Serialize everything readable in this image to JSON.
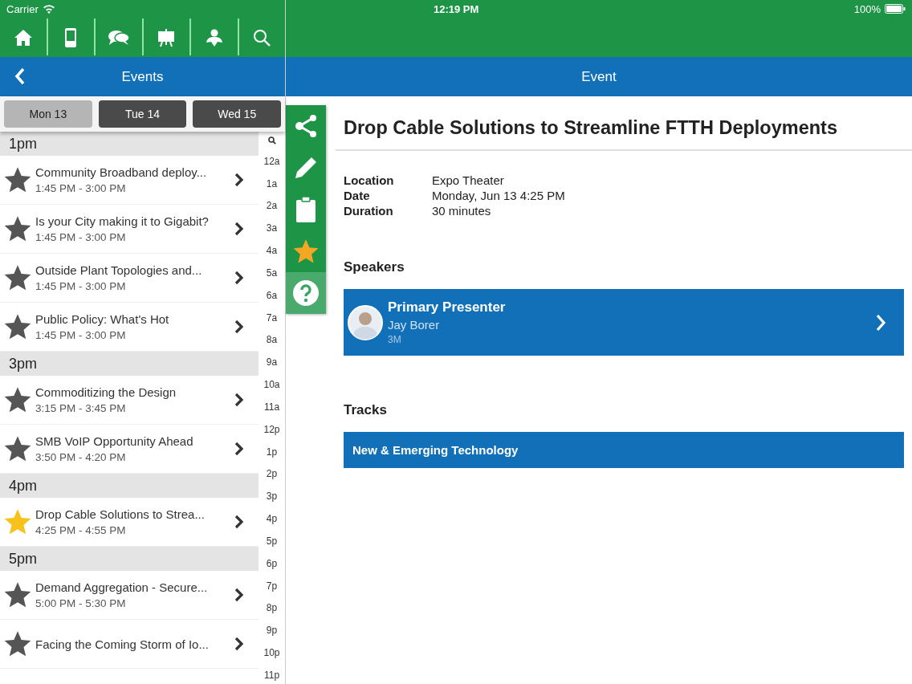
{
  "status_bar": {
    "carrier": "Carrier",
    "time": "12:19 PM",
    "battery": "100%"
  },
  "toolbar": [
    {
      "kind": "home"
    },
    {
      "kind": "device"
    },
    {
      "kind": "chat"
    },
    {
      "kind": "easel"
    },
    {
      "kind": "person"
    },
    {
      "kind": "search"
    }
  ],
  "left_header": {
    "title": "Events"
  },
  "day_tabs": [
    {
      "label": "Mon 13",
      "selected": true
    },
    {
      "label": "Tue 14",
      "selected": false
    },
    {
      "label": "Wed 15",
      "selected": false
    }
  ],
  "sections": [
    {
      "heading": "1pm",
      "events": [
        {
          "title": "Community Broadband deploy...",
          "time": "1:45 PM - 3:00 PM",
          "favorite": false
        },
        {
          "title": "Is your City making it to Gigabit?",
          "time": "1:45 PM - 3:00 PM",
          "favorite": false
        },
        {
          "title": "Outside Plant Topologies and...",
          "time": "1:45 PM - 3:00 PM",
          "favorite": false
        },
        {
          "title": "Public Policy: What's Hot",
          "time": "1:45 PM - 3:00 PM",
          "favorite": false
        }
      ]
    },
    {
      "heading": "3pm",
      "events": [
        {
          "title": "Commoditizing the Design",
          "time": "3:15 PM - 3:45 PM",
          "favorite": false
        },
        {
          "title": "SMB VoIP Opportunity Ahead",
          "time": "3:50 PM - 4:20 PM",
          "favorite": false
        }
      ]
    },
    {
      "heading": "4pm",
      "events": [
        {
          "title": "Drop Cable Solutions to Strea...",
          "time": "4:25 PM - 4:55 PM",
          "favorite": true
        }
      ]
    },
    {
      "heading": "5pm",
      "events": [
        {
          "title": "Demand Aggregation - Secure...",
          "time": "5:00 PM - 5:30 PM",
          "favorite": false
        },
        {
          "title": "Facing the Coming Storm of Io...",
          "favorite": false
        }
      ]
    }
  ],
  "time_index": [
    "12a",
    "1a",
    "2a",
    "3a",
    "4a",
    "5a",
    "6a",
    "7a",
    "8a",
    "9a",
    "10a",
    "11a",
    "12p",
    "1p",
    "2p",
    "3p",
    "4p",
    "5p",
    "6p",
    "7p",
    "8p",
    "9p",
    "10p",
    "11p"
  ],
  "right_header": {
    "title": "Event"
  },
  "action_rail": {
    "favorite": true
  },
  "event": {
    "title": "Drop Cable Solutions to Streamline FTTH Deployments",
    "details": [
      {
        "label": "Location",
        "value": "Expo Theater"
      },
      {
        "label": "Date",
        "value": "Monday, Jun 13 4:25 PM"
      },
      {
        "label": "Duration",
        "value": "30 minutes"
      }
    ],
    "speakers_heading": "Speakers",
    "speakers": [
      {
        "role": "Primary Presenter",
        "name": "Jay Borer",
        "company": "3M"
      }
    ],
    "tracks_heading": "Tracks",
    "tracks": [
      "New & Emerging Technology"
    ]
  }
}
